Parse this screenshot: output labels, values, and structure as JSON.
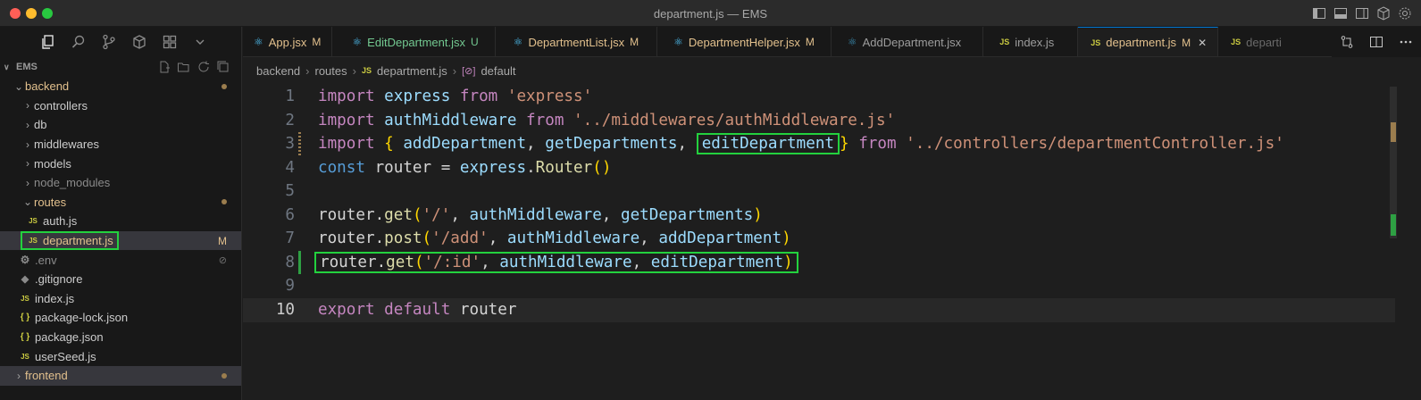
{
  "window": {
    "title": "department.js — EMS"
  },
  "activity_icons": [
    "files-icon",
    "search-icon",
    "source-control-icon",
    "extensions-icon",
    "remote-icon",
    "chevron-down-icon"
  ],
  "explorer": {
    "root": "EMS",
    "items": [
      {
        "label": "backend",
        "kind": "folder",
        "open": true,
        "modified": true
      },
      {
        "label": "controllers",
        "kind": "folder"
      },
      {
        "label": "db",
        "kind": "folder"
      },
      {
        "label": "middlewares",
        "kind": "folder"
      },
      {
        "label": "models",
        "kind": "folder"
      },
      {
        "label": "node_modules",
        "kind": "folder"
      },
      {
        "label": "routes",
        "kind": "folder",
        "open": true,
        "modified": true
      },
      {
        "label": "auth.js",
        "kind": "js"
      },
      {
        "label": "department.js",
        "kind": "js",
        "badge": "M"
      },
      {
        "label": ".env",
        "kind": "env"
      },
      {
        "label": ".gitignore",
        "kind": "git"
      },
      {
        "label": "index.js",
        "kind": "js"
      },
      {
        "label": "package-lock.json",
        "kind": "json"
      },
      {
        "label": "package.json",
        "kind": "json"
      },
      {
        "label": "userSeed.js",
        "kind": "js"
      },
      {
        "label": "frontend",
        "kind": "folder",
        "modified": true
      }
    ],
    "icons": {
      "js": "JS",
      "json": "{ }",
      "env": "⚙",
      "git": "◆"
    }
  },
  "tabs": [
    {
      "label": "App.jsx",
      "mark": "M",
      "icon": "react-icon"
    },
    {
      "label": "EditDepartment.jsx",
      "mark": "U",
      "icon": "react-icon"
    },
    {
      "label": "DepartmentList.jsx",
      "mark": "M",
      "icon": "react-icon"
    },
    {
      "label": "DepartmentHelper.jsx",
      "mark": "M",
      "icon": "react-icon"
    },
    {
      "label": "AddDepartment.jsx",
      "mark": "",
      "icon": "react-icon"
    },
    {
      "label": "index.js",
      "mark": "",
      "icon": "js-icon"
    },
    {
      "label": "department.js",
      "mark": "M",
      "icon": "js-icon",
      "active": true
    },
    {
      "label": "departi",
      "mark": "",
      "icon": "js-icon"
    }
  ],
  "breadcrumb": {
    "p1": "backend",
    "p2": "routes",
    "p3": "department.js",
    "p4": "default",
    "js": "JS"
  },
  "editor": {
    "line_numbers": [
      "1",
      "2",
      "3",
      "4",
      "5",
      "6",
      "7",
      "8",
      "9",
      "10"
    ],
    "l1": [
      "import",
      " ",
      "express",
      " ",
      "from",
      " ",
      "'express'"
    ],
    "l2": [
      "import",
      " ",
      "authMiddleware",
      " ",
      "from",
      " ",
      "'../middlewares/authMiddleware.js'"
    ],
    "l3": [
      "import",
      " ",
      "{",
      " ",
      "addDepartment",
      ", ",
      "getDepartments",
      ", ",
      "editDepartment",
      "}",
      " ",
      "from",
      " ",
      "'../controllers/departmentController.js'"
    ],
    "l4": [
      "const",
      " ",
      "router",
      " = ",
      "express",
      ".",
      "Router",
      "(",
      ")"
    ],
    "l6": [
      "router",
      ".",
      "get",
      "(",
      "'/'",
      ", ",
      "authMiddleware",
      ", ",
      "getDepartments",
      ")"
    ],
    "l7": [
      "router",
      ".",
      "post",
      "(",
      "'/add'",
      ", ",
      "authMiddleware",
      ", ",
      "addDepartment",
      ")"
    ],
    "l8": [
      "router",
      ".",
      "get",
      "(",
      "'/:id'",
      ", ",
      "authMiddleware",
      ", ",
      "editDepartment",
      ")"
    ],
    "l10": [
      "export",
      " ",
      "default",
      " ",
      "router"
    ]
  },
  "colors": {
    "accent": "#23d13e",
    "modified": "#e2c08d",
    "untracked": "#73c991"
  }
}
